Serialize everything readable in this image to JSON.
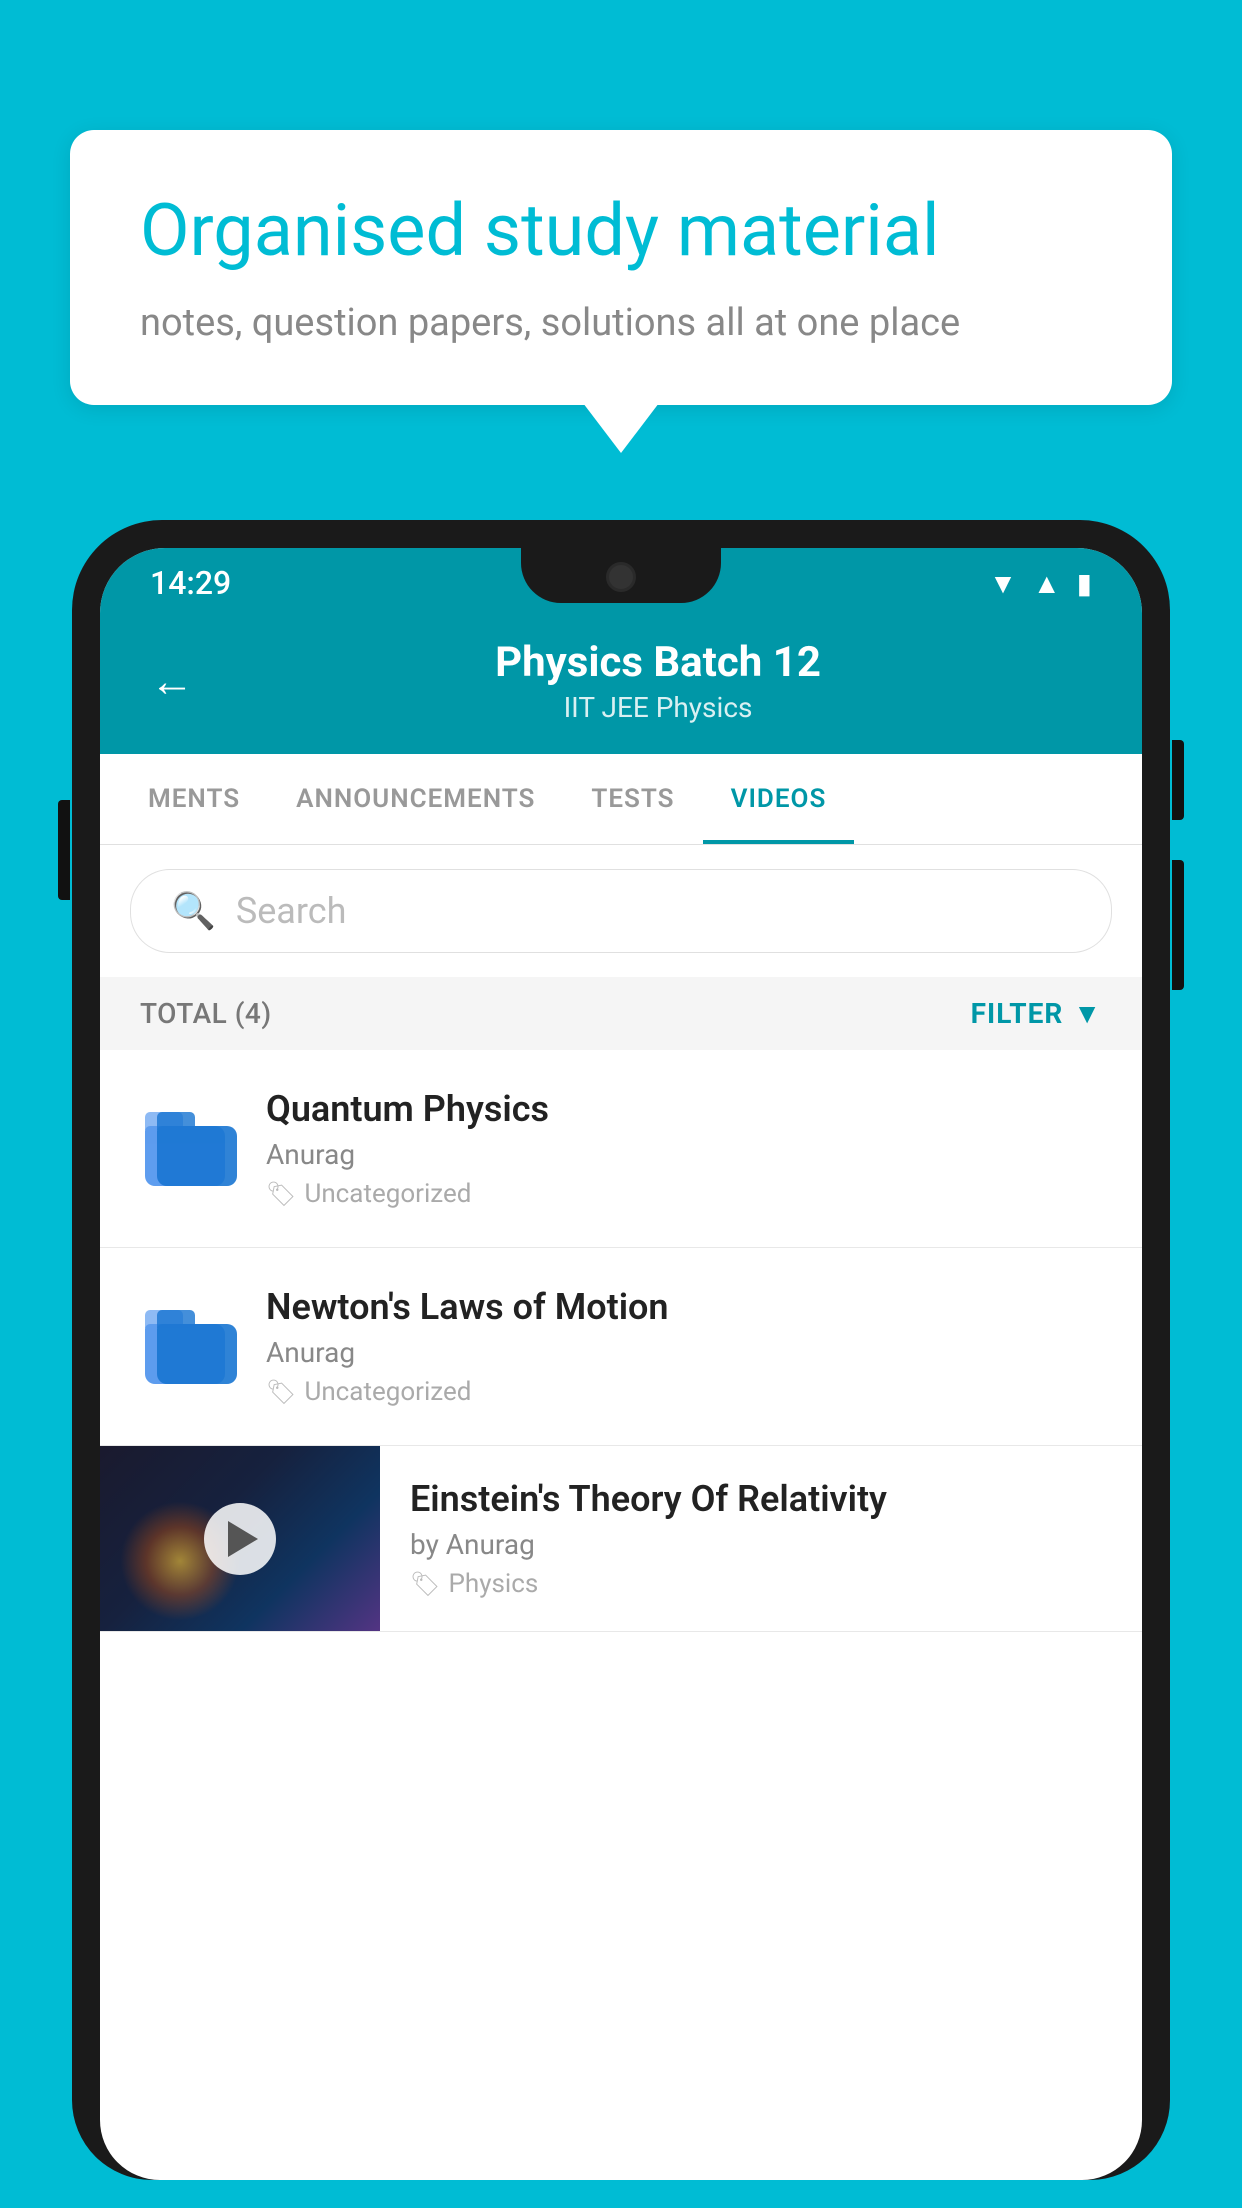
{
  "background": {
    "color": "#00bcd4"
  },
  "speech_bubble": {
    "title": "Organised study material",
    "subtitle": "notes, question papers, solutions all at one place"
  },
  "phone": {
    "status_bar": {
      "time": "14:29"
    },
    "header": {
      "back_label": "←",
      "title": "Physics Batch 12",
      "subtitle": "IIT JEE   Physics"
    },
    "tabs": [
      {
        "label": "MENTS",
        "active": false
      },
      {
        "label": "ANNOUNCEMENTS",
        "active": false
      },
      {
        "label": "TESTS",
        "active": false
      },
      {
        "label": "VIDEOS",
        "active": true
      }
    ],
    "search": {
      "placeholder": "Search"
    },
    "filter": {
      "total_label": "TOTAL (4)",
      "filter_label": "FILTER"
    },
    "videos": [
      {
        "id": 1,
        "title": "Quantum Physics",
        "author": "Anurag",
        "tag": "Uncategorized",
        "has_thumb": false
      },
      {
        "id": 2,
        "title": "Newton's Laws of Motion",
        "author": "Anurag",
        "tag": "Uncategorized",
        "has_thumb": false
      },
      {
        "id": 3,
        "title": "Einstein's Theory Of Relativity",
        "author": "by Anurag",
        "tag": "Physics",
        "has_thumb": true
      }
    ]
  }
}
